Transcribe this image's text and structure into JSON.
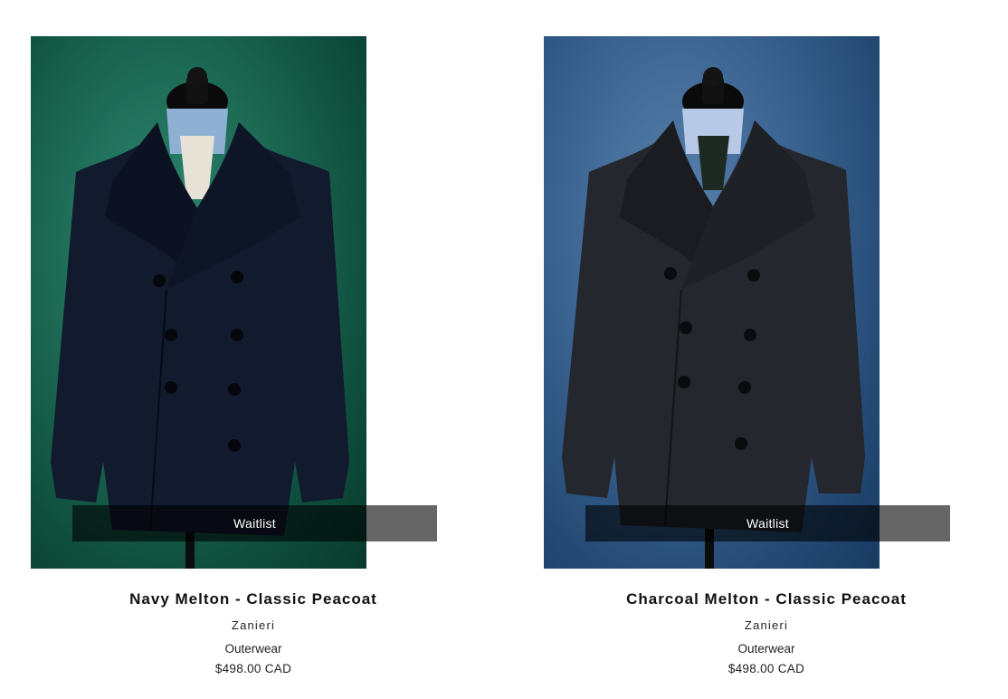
{
  "products": [
    {
      "image_alt": "Navy peacoat on mannequin",
      "waitlist_label": "Waitlist",
      "title": "Navy Melton - Classic Peacoat",
      "brand": "Zanieri",
      "category": "Outerwear",
      "price": "$498.00 CAD",
      "background_color": "#1d6a55",
      "coat_color": "#121a2e"
    },
    {
      "image_alt": "Charcoal peacoat on mannequin",
      "waitlist_label": "Waitlist",
      "title": "Charcoal Melton - Classic Peacoat",
      "brand": "Zanieri",
      "category": "Outerwear",
      "price": "$498.00 CAD",
      "background_color": "#3d6593",
      "coat_color": "#24272d"
    }
  ]
}
